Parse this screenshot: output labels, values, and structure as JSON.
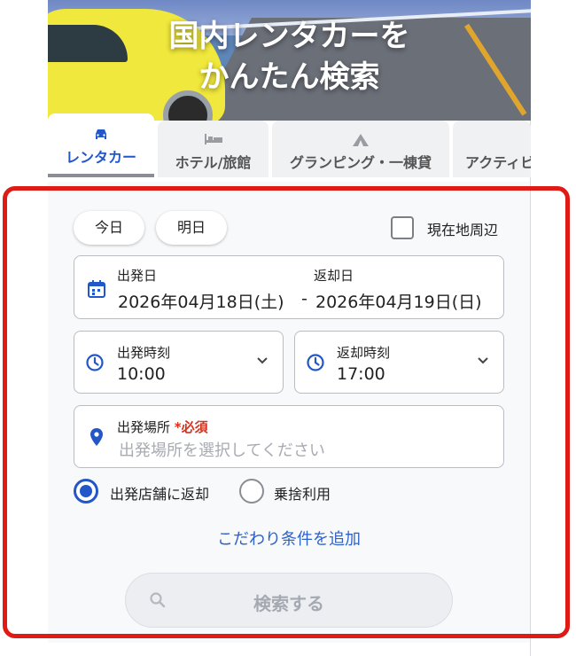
{
  "hero": {
    "title": "国内レンタカーを\nかんたん検索"
  },
  "tabs": [
    {
      "label": "レンタカー",
      "icon": "car-icon",
      "active": true
    },
    {
      "label": "ホテル/旅館",
      "icon": "bed-icon",
      "active": false
    },
    {
      "label": "グランピング・一棟貸",
      "icon": "tent-icon",
      "active": false
    },
    {
      "label": "アクティビ",
      "icon": "activity-icon",
      "active": false
    }
  ],
  "quick_dates": {
    "today": "今日",
    "tomorrow": "明日"
  },
  "nearby": {
    "label": "現在地周辺",
    "checked": false
  },
  "dates": {
    "departure_label": "出発日",
    "departure_value": "2026年04月18日(土)",
    "separator": "-",
    "return_label": "返却日",
    "return_value": "2026年04月19日(日)"
  },
  "times": {
    "departure_label": "出発時刻",
    "departure_value": "10:00",
    "return_label": "返却時刻",
    "return_value": "17:00"
  },
  "location": {
    "label": "出発場所",
    "required": "*必須",
    "placeholder": "出発場所を選択してください"
  },
  "return_options": [
    {
      "label": "出発店舗に返却",
      "selected": true
    },
    {
      "label": "乗捨利用",
      "selected": false
    }
  ],
  "add_conditions": "こだわり条件を追加",
  "search_button": "検索する",
  "colors": {
    "accent": "#2356c6",
    "highlight": "#e01b16",
    "required": "#d4331f"
  }
}
